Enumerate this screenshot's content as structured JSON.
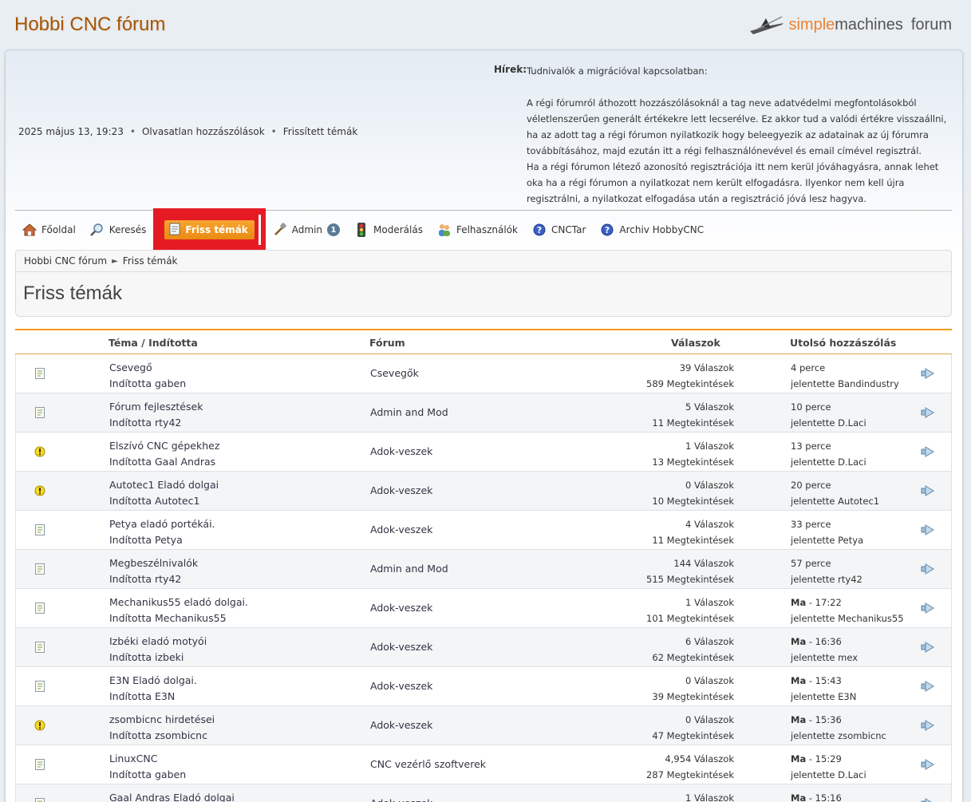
{
  "header": {
    "forum_title": "Hobbi CNC fórum",
    "logo_main": "simple",
    "logo_mid": "machines",
    "logo_sub": "forum"
  },
  "info": {
    "date": "2025 május 13, 19:23",
    "unread": "Olvasatlan hozzászólások",
    "updated": "Frissített témák"
  },
  "news": {
    "label": "Hírek:",
    "title": "Tudnivalók a migrációval kapcsolatban:",
    "p1": "A régi fórumról áthozott hozzászólásoknál a tag neve adatvédelmi megfontolásokból véletlenszerűen generált értékekre lett  lecserélve. Ez akkor tud a valódi értékre visszaállni, ha az adott tag a régi fórumon nyilatkozik hogy beleegyezik az adatainak az új fórumra továbbításához, majd ezután itt a régi felhasználónevével és email címével regisztrál.",
    "p2": "Ha a régi fórumon létező azonosító regisztrációja itt nem kerül jóváhagyásra, annak lehet oka ha a régi fórumon a nyilatkozat nem került elfogadásra. Ilyenkor nem kell újra regisztrálni, a nyilatkozat elfogadása után a regisztráció jóvá lesz hagyva."
  },
  "menu": {
    "home": "Főoldal",
    "search": "Keresés",
    "recent": "Friss témák",
    "admin": "Admin",
    "admin_badge": "1",
    "moderation": "Moderálás",
    "members": "Felhasználók",
    "cnctar": "CNCTar",
    "archive": "Archiv HobbyCNC"
  },
  "breadcrumb": {
    "root": "Hobbi CNC fórum",
    "current": "Friss témák"
  },
  "page_title": "Friss témák",
  "table": {
    "headers": {
      "topic": "Téma / Indította",
      "forum": "Fórum",
      "replies": "Válaszok",
      "last": "Utolsó hozzászólás"
    },
    "rows": [
      {
        "icon": "topic-icon",
        "title": "Csevegő",
        "starter": "Indította gaben",
        "forum": "Csevegők",
        "replies": "39 Válaszok",
        "views": "589 Megtekintések",
        "last_bold": "",
        "last_time": "4 perce",
        "last_by": "jelentette Bandindustry"
      },
      {
        "icon": "topic-icon",
        "title": "Fórum fejlesztések",
        "starter": "Indította rty42",
        "forum": "Admin and Mod",
        "replies": "5 Válaszok",
        "views": "11 Megtekintések",
        "last_bold": "",
        "last_time": "10 perce",
        "last_by": "jelentette D.Laci"
      },
      {
        "icon": "warning-icon",
        "title": "Elszívó CNC gépekhez",
        "starter": "Indította Gaal Andras",
        "forum": "Adok-veszek",
        "replies": "1 Válaszok",
        "views": "13 Megtekintések",
        "last_bold": "",
        "last_time": "13 perce",
        "last_by": "jelentette D.Laci"
      },
      {
        "icon": "warning-icon",
        "title": "Autotec1 Eladó dolgai",
        "starter": "Indította Autotec1",
        "forum": "Adok-veszek",
        "replies": "0 Válaszok",
        "views": "10 Megtekintések",
        "last_bold": "",
        "last_time": "20 perce",
        "last_by": "jelentette Autotec1"
      },
      {
        "icon": "topic-icon",
        "title": "Petya eladó portékái.",
        "starter": "Indította Petya",
        "forum": "Adok-veszek",
        "replies": "4 Válaszok",
        "views": "11 Megtekintések",
        "last_bold": "",
        "last_time": "33 perce",
        "last_by": "jelentette Petya"
      },
      {
        "icon": "topic-icon",
        "title": "Megbeszélnivalók",
        "starter": "Indította rty42",
        "forum": "Admin and Mod",
        "replies": "144 Válaszok",
        "views": "515 Megtekintések",
        "last_bold": "",
        "last_time": "57 perce",
        "last_by": "jelentette rty42"
      },
      {
        "icon": "topic-icon",
        "title": "Mechanikus55 eladó dolgai.",
        "starter": "Indította Mechanikus55",
        "forum": "Adok-veszek",
        "replies": "1 Válaszok",
        "views": "101 Megtekintések",
        "last_bold": "Ma",
        "last_time": " - 17:22",
        "last_by": "jelentette Mechanikus55"
      },
      {
        "icon": "topic-icon",
        "title": "Izbéki eladó motyói",
        "starter": "Indította izbeki",
        "forum": "Adok-veszek",
        "replies": "6 Válaszok",
        "views": "62 Megtekintések",
        "last_bold": "Ma",
        "last_time": " - 16:36",
        "last_by": "jelentette mex"
      },
      {
        "icon": "topic-icon",
        "title": "E3N Eladó dolgai.",
        "starter": "Indította E3N",
        "forum": "Adok-veszek",
        "replies": "0 Válaszok",
        "views": "39 Megtekintések",
        "last_bold": "Ma",
        "last_time": " - 15:43",
        "last_by": "jelentette E3N"
      },
      {
        "icon": "warning-icon",
        "title": "zsombicnc hirdetései",
        "starter": "Indította zsombicnc",
        "forum": "Adok-veszek",
        "replies": "0 Válaszok",
        "views": "47 Megtekintések",
        "last_bold": "Ma",
        "last_time": " - 15:36",
        "last_by": "jelentette zsombicnc"
      },
      {
        "icon": "topic-icon",
        "title": "LinuxCNC",
        "starter": "Indította gaben",
        "forum": "CNC vezérlő szoftverek",
        "replies": "4,954 Válaszok",
        "views": "287 Megtekintések",
        "last_bold": "Ma",
        "last_time": " - 15:29",
        "last_by": "jelentette D.Laci"
      },
      {
        "icon": "topic-icon",
        "title": "Gaal Andras Eladó dolgai",
        "starter": "",
        "forum": "Adok-veszek",
        "replies": "1 Válaszok",
        "views": "",
        "last_bold": "Ma",
        "last_time": " - 15:16",
        "last_by": ""
      }
    ]
  }
}
